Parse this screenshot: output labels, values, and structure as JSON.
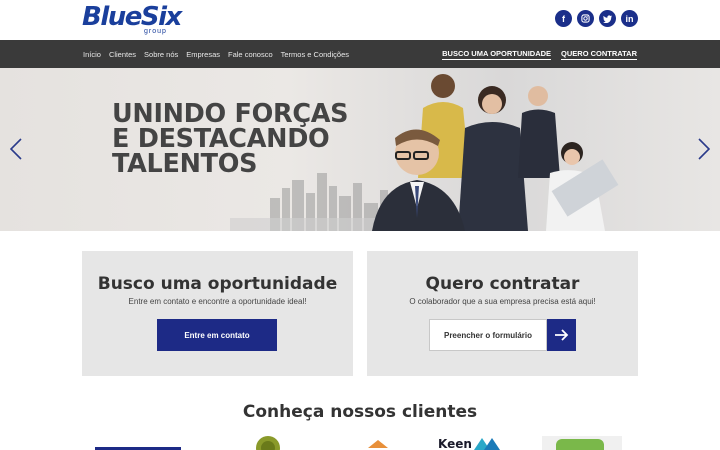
{
  "brand": {
    "name": "BlueSix",
    "sub": "group"
  },
  "socials": [
    {
      "label": "f",
      "icon": "facebook-icon"
    },
    {
      "label": "◎",
      "icon": "instagram-icon"
    },
    {
      "label": "t",
      "icon": "twitter-icon"
    },
    {
      "label": "in",
      "icon": "linkedin-icon"
    }
  ],
  "nav": {
    "left": [
      "Início",
      "Clientes",
      "Sobre nós",
      "Empresas",
      "Fale conosco",
      "Termos e Condições"
    ],
    "right": [
      "BUSCO UMA OPORTUNIDADE",
      "QUERO CONTRATAR"
    ]
  },
  "hero": {
    "lines": [
      "UNINDO FORÇAS",
      "E DESTACANDO",
      "TALENTOS"
    ]
  },
  "cards": {
    "opportunity": {
      "title": "Busco uma oportunidade",
      "subtitle": "Entre em contato e encontre a oportunidade ideal!",
      "button": "Entre em contato"
    },
    "hire": {
      "title": "Quero contratar",
      "subtitle": "O colaborador que a sua empresa precisa está aqui!",
      "button": "Preencher o formulário"
    }
  },
  "clients": {
    "title": "Conheça nossos clientes",
    "logos": [
      "Keen"
    ]
  },
  "colors": {
    "brand_blue": "#1d2a86",
    "nav_bg": "#3a3a3a",
    "card_bg": "#e6e6e6"
  }
}
